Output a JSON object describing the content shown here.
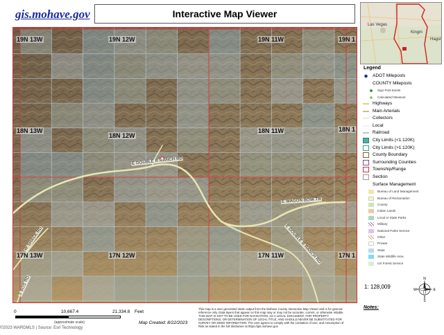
{
  "header": {
    "site_link": "gis.mohave.gov",
    "title": "Interactive Map Viewer"
  },
  "map": {
    "township_labels": [
      {
        "id": "t1",
        "text": "19N 13W"
      },
      {
        "id": "t2",
        "text": "19N 12W"
      },
      {
        "id": "t3",
        "text": "19N 11W"
      },
      {
        "id": "t4",
        "text": "19N 1"
      },
      {
        "id": "t5",
        "text": "18N 13W"
      },
      {
        "id": "t6",
        "text": "18N 12W"
      },
      {
        "id": "t7",
        "text": "18N 11W"
      },
      {
        "id": "t8",
        "text": "18N 1"
      },
      {
        "id": "t9",
        "text": "17N 13W"
      },
      {
        "id": "t10",
        "text": "17N 12W"
      },
      {
        "id": "t11",
        "text": "17N 11W"
      },
      {
        "id": "t12",
        "text": "17N 1"
      }
    ],
    "road_labels": [
      {
        "id": "r1",
        "text": "E DOUBLE R RANCH RD"
      },
      {
        "id": "r2",
        "text": "E WAGON BOW TR"
      },
      {
        "id": "r3",
        "text": "E DOUBLE R RANCH RD"
      },
      {
        "id": "r4",
        "text": "W SHACK RD"
      },
      {
        "id": "r5",
        "text": "S BOS RD"
      }
    ]
  },
  "overview": {
    "labels": [
      "Las Vegas",
      "Kingm",
      "Hagst"
    ],
    "accent_color": "#cc2222"
  },
  "legend": {
    "title": "Legend",
    "items": [
      {
        "label": "ADOT Mileposts",
        "symbol": "dot-blue",
        "small": false
      },
      {
        "label": "COUNTY Mileposts",
        "symbol": "none",
        "small": false
      },
      {
        "label": "Sign Post Exists",
        "symbol": "dot-green",
        "small": true
      },
      {
        "label": "Calculated Measure",
        "symbol": "dot-lightgreen",
        "small": true
      },
      {
        "label": "Highways",
        "symbol": "line-yellow",
        "small": false
      },
      {
        "label": "Main Arterials",
        "symbol": "line-tan",
        "small": false
      },
      {
        "label": "Collectors",
        "symbol": "line-light",
        "small": false
      },
      {
        "label": "Local",
        "symbol": "line-lighter",
        "small": false
      },
      {
        "label": "Railroad",
        "symbol": "line-gray",
        "small": false
      },
      {
        "label": "City Limits (<1:120K)",
        "symbol": "box-teal",
        "small": false
      },
      {
        "label": "City Limits (>1:120K)",
        "symbol": "box-teal-outline",
        "small": false
      },
      {
        "label": "County Boundary",
        "symbol": "box-brown",
        "small": false
      },
      {
        "label": "Surrounding Counties",
        "symbol": "box-purple",
        "small": false
      },
      {
        "label": "Township/Range",
        "symbol": "box-red",
        "small": false
      },
      {
        "label": "Section",
        "symbol": "box-gray",
        "small": false
      },
      {
        "label": "Surface Management",
        "symbol": "none",
        "small": false
      },
      {
        "label": "Bureau of Land Management",
        "symbol": "fill-blm",
        "small": true
      },
      {
        "label": "Bureau of Reclamation",
        "symbol": "fill-bor",
        "small": true
      },
      {
        "label": "County",
        "symbol": "fill-county",
        "small": true
      },
      {
        "label": "Indian Lands",
        "symbol": "fill-indian",
        "small": true
      },
      {
        "label": "Local or State Parks",
        "symbol": "fill-parks",
        "small": true
      },
      {
        "label": "Military",
        "symbol": "fill-military",
        "small": true
      },
      {
        "label": "National Parks Service",
        "symbol": "fill-nps",
        "small": true
      },
      {
        "label": "Other",
        "symbol": "fill-other",
        "small": true
      },
      {
        "label": "Private",
        "symbol": "fill-private",
        "small": true
      },
      {
        "label": "State",
        "symbol": "fill-state",
        "small": true
      },
      {
        "label": "State Wildlife Area",
        "symbol": "fill-wildlife",
        "small": true
      },
      {
        "label": "US Forest Service",
        "symbol": "fill-usfs",
        "small": true
      }
    ],
    "scale_ratio": "1: 128,009",
    "north_letters": {
      "n": "N",
      "s": "S",
      "e": "E",
      "w": "W"
    }
  },
  "footer": {
    "scale_start": "0",
    "scale_mid": "10,667.4",
    "scale_end": "21,334.8",
    "scale_unit": "Feet",
    "scale_note": "(approximate scale)",
    "created": "Map Created: 8/22/2023",
    "disclaimer": "This map is a user generated static output from the Mohave County Interactive Map Viewer and is for general reference only. Data layers that appear on this map may or may not be accurate, current, or otherwise reliable. THIS MAP IS NOT TO BE USED FOR NAVIGATION, AS A LEGAL DOCUMENT, FOR PROPERTY DESCRIPTIONS, OR DETERMINATION OF LEGAL TITLE, AND SHOULD NEVER BE SUBSTITUTED FOR SURVEY OR DEED INFORMATION. The user agrees to comply with the Limitation of Use, and Assumption of Risk as stated in the full disclaimer at https://gis.mohave.gov",
    "notes_label": "Notes:",
    "copyright": "©2023 WARDMLS | Source: Esri Technology"
  }
}
